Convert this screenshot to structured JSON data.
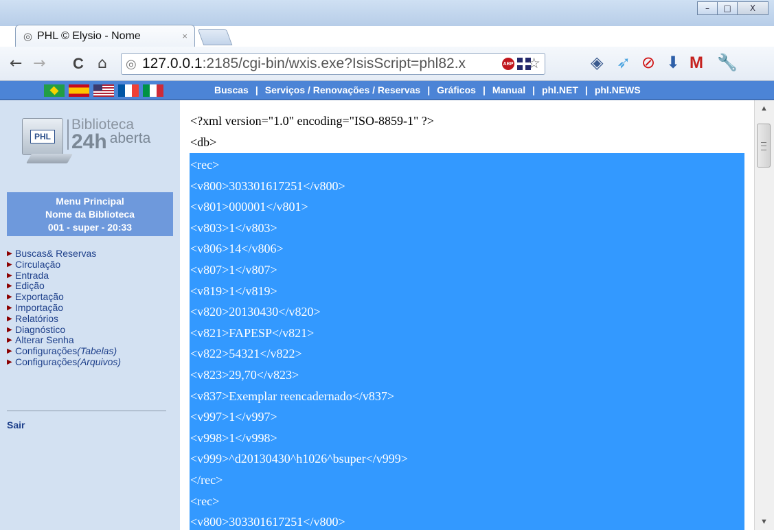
{
  "window": {
    "min": "–",
    "max": "□",
    "close": "X"
  },
  "tab": {
    "favicon": "◎",
    "title": "PHL © Elysio - Nome",
    "close": "×"
  },
  "toolbar": {
    "back": "←",
    "forward": "→",
    "reload": "C",
    "home": "⌂",
    "url_host": "127.0.0.1",
    "url_rest": ":2185/cgi-bin/wxis.exe?IsisScript=phl82.x",
    "abp": "ABP",
    "star": "☆"
  },
  "extensions": [
    {
      "name": "ext-eye-icon",
      "glyph": "◈",
      "color": "#3b5b8f"
    },
    {
      "name": "ext-bird-icon",
      "glyph": "➶",
      "color": "#4aa3df"
    },
    {
      "name": "ext-block-icon",
      "glyph": "⊘",
      "color": "#d01010"
    },
    {
      "name": "ext-download-icon",
      "glyph": "⬇",
      "color": "#2d5fa8"
    },
    {
      "name": "ext-gmail-icon",
      "glyph": "M",
      "color": "#c5221f"
    },
    {
      "name": "wrench-icon",
      "glyph": "🔧",
      "color": "#444"
    }
  ],
  "nav": {
    "items": [
      "Buscas",
      "Serviços / Renovações / Reservas",
      "Gráficos",
      "Manual",
      "phl.NET",
      "phl.NEWS"
    ],
    "separator": "|"
  },
  "logo": {
    "line1": "Biblioteca",
    "line2": "24h",
    "line2_suffix": "aberta",
    "monitor": "PHL"
  },
  "menu": {
    "head1": "Menu Principal",
    "head2": "Nome da Biblioteca",
    "head3": "001 - super - 20:33",
    "items": [
      {
        "label": "Buscas& Reservas"
      },
      {
        "label": "Circulação"
      },
      {
        "label": "Entrada"
      },
      {
        "label": "Edição"
      },
      {
        "label": "Exportação"
      },
      {
        "label": "Importação"
      },
      {
        "label": "Relatórios"
      },
      {
        "label": "Diagnóstico"
      },
      {
        "label": "Alterar Senha"
      },
      {
        "label": "Configurações",
        "italic": "(Tabelas)"
      },
      {
        "label": "Configurações",
        "italic": "(Arquivos)"
      }
    ],
    "exit": "Sair"
  },
  "xml": {
    "header": [
      "<?xml version=\"1.0\" encoding=\"ISO-8859-1\" ?>",
      "<db>"
    ],
    "selected": [
      "<rec>",
      "<v800>303301617251</v800>",
      "<v801>000001</v801>",
      "<v803>1</v803>",
      "<v806>14</v806>",
      "<v807>1</v807>",
      "<v819>1</v819>",
      "<v820>20130430</v820>",
      "<v821>FAPESP</v821>",
      "<v822>54321</v822>",
      "<v823>29,70</v823>",
      "<v837>Exemplar reencadernado</v837>",
      "<v997>1</v997>",
      "<v998>1</v998>",
      "<v999>^d20130430^h1026^bsuper</v999>",
      "</rec>",
      "<rec>",
      "<v800>303301617251</v800>"
    ]
  },
  "scroll": {
    "up": "▲",
    "down": "▼"
  }
}
